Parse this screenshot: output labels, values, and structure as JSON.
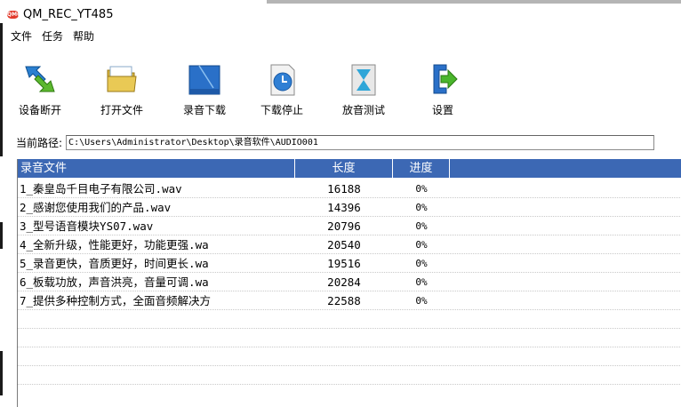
{
  "window": {
    "title": "QM_REC_YT485",
    "icon_text": "QMC"
  },
  "menu": [
    {
      "label": "文件"
    },
    {
      "label": "任务"
    },
    {
      "label": "帮助"
    }
  ],
  "toolbar": {
    "disconnect": {
      "label": "设备断开",
      "icon": "device-disconnect-icon"
    },
    "open_file": {
      "label": "打开文件",
      "icon": "folder-icon"
    },
    "record_download": {
      "label": "录音下载",
      "icon": "record-download-icon"
    },
    "stop_download": {
      "label": "下载停止",
      "icon": "clock-stop-icon"
    },
    "play_test": {
      "label": "放音测试",
      "icon": "hourglass-icon"
    },
    "settings": {
      "label": "设置",
      "icon": "exit-arrow-icon"
    }
  },
  "path": {
    "label": "当前路径:",
    "value": "C:\\Users\\Administrator\\Desktop\\录音软件\\AUDIO001"
  },
  "list": {
    "headers": {
      "name": "录音文件",
      "length": "长度",
      "progress": "进度"
    },
    "rows": [
      {
        "name": "1_秦皇岛千目电子有限公司.wav",
        "length": "16188",
        "progress": "0%"
      },
      {
        "name": "2_感谢您使用我们的产品.wav",
        "length": "14396",
        "progress": "0%"
      },
      {
        "name": "3_型号语音模块YS07.wav",
        "length": "20796",
        "progress": "0%"
      },
      {
        "name": "4_全新升级，性能更好，功能更强.wa",
        "length": "20540",
        "progress": "0%"
      },
      {
        "name": "5_录音更快，音质更好，时间更长.wa",
        "length": "19516",
        "progress": "0%"
      },
      {
        "name": "6_板载功放，声音洪亮，音量可调.wa",
        "length": "20284",
        "progress": "0%"
      },
      {
        "name": "7_提供多种控制方式，全面音频解决方",
        "length": "22588",
        "progress": "0%"
      }
    ]
  },
  "colors": {
    "header_bg": "#3c68b4",
    "header_text": "#ffffff"
  }
}
